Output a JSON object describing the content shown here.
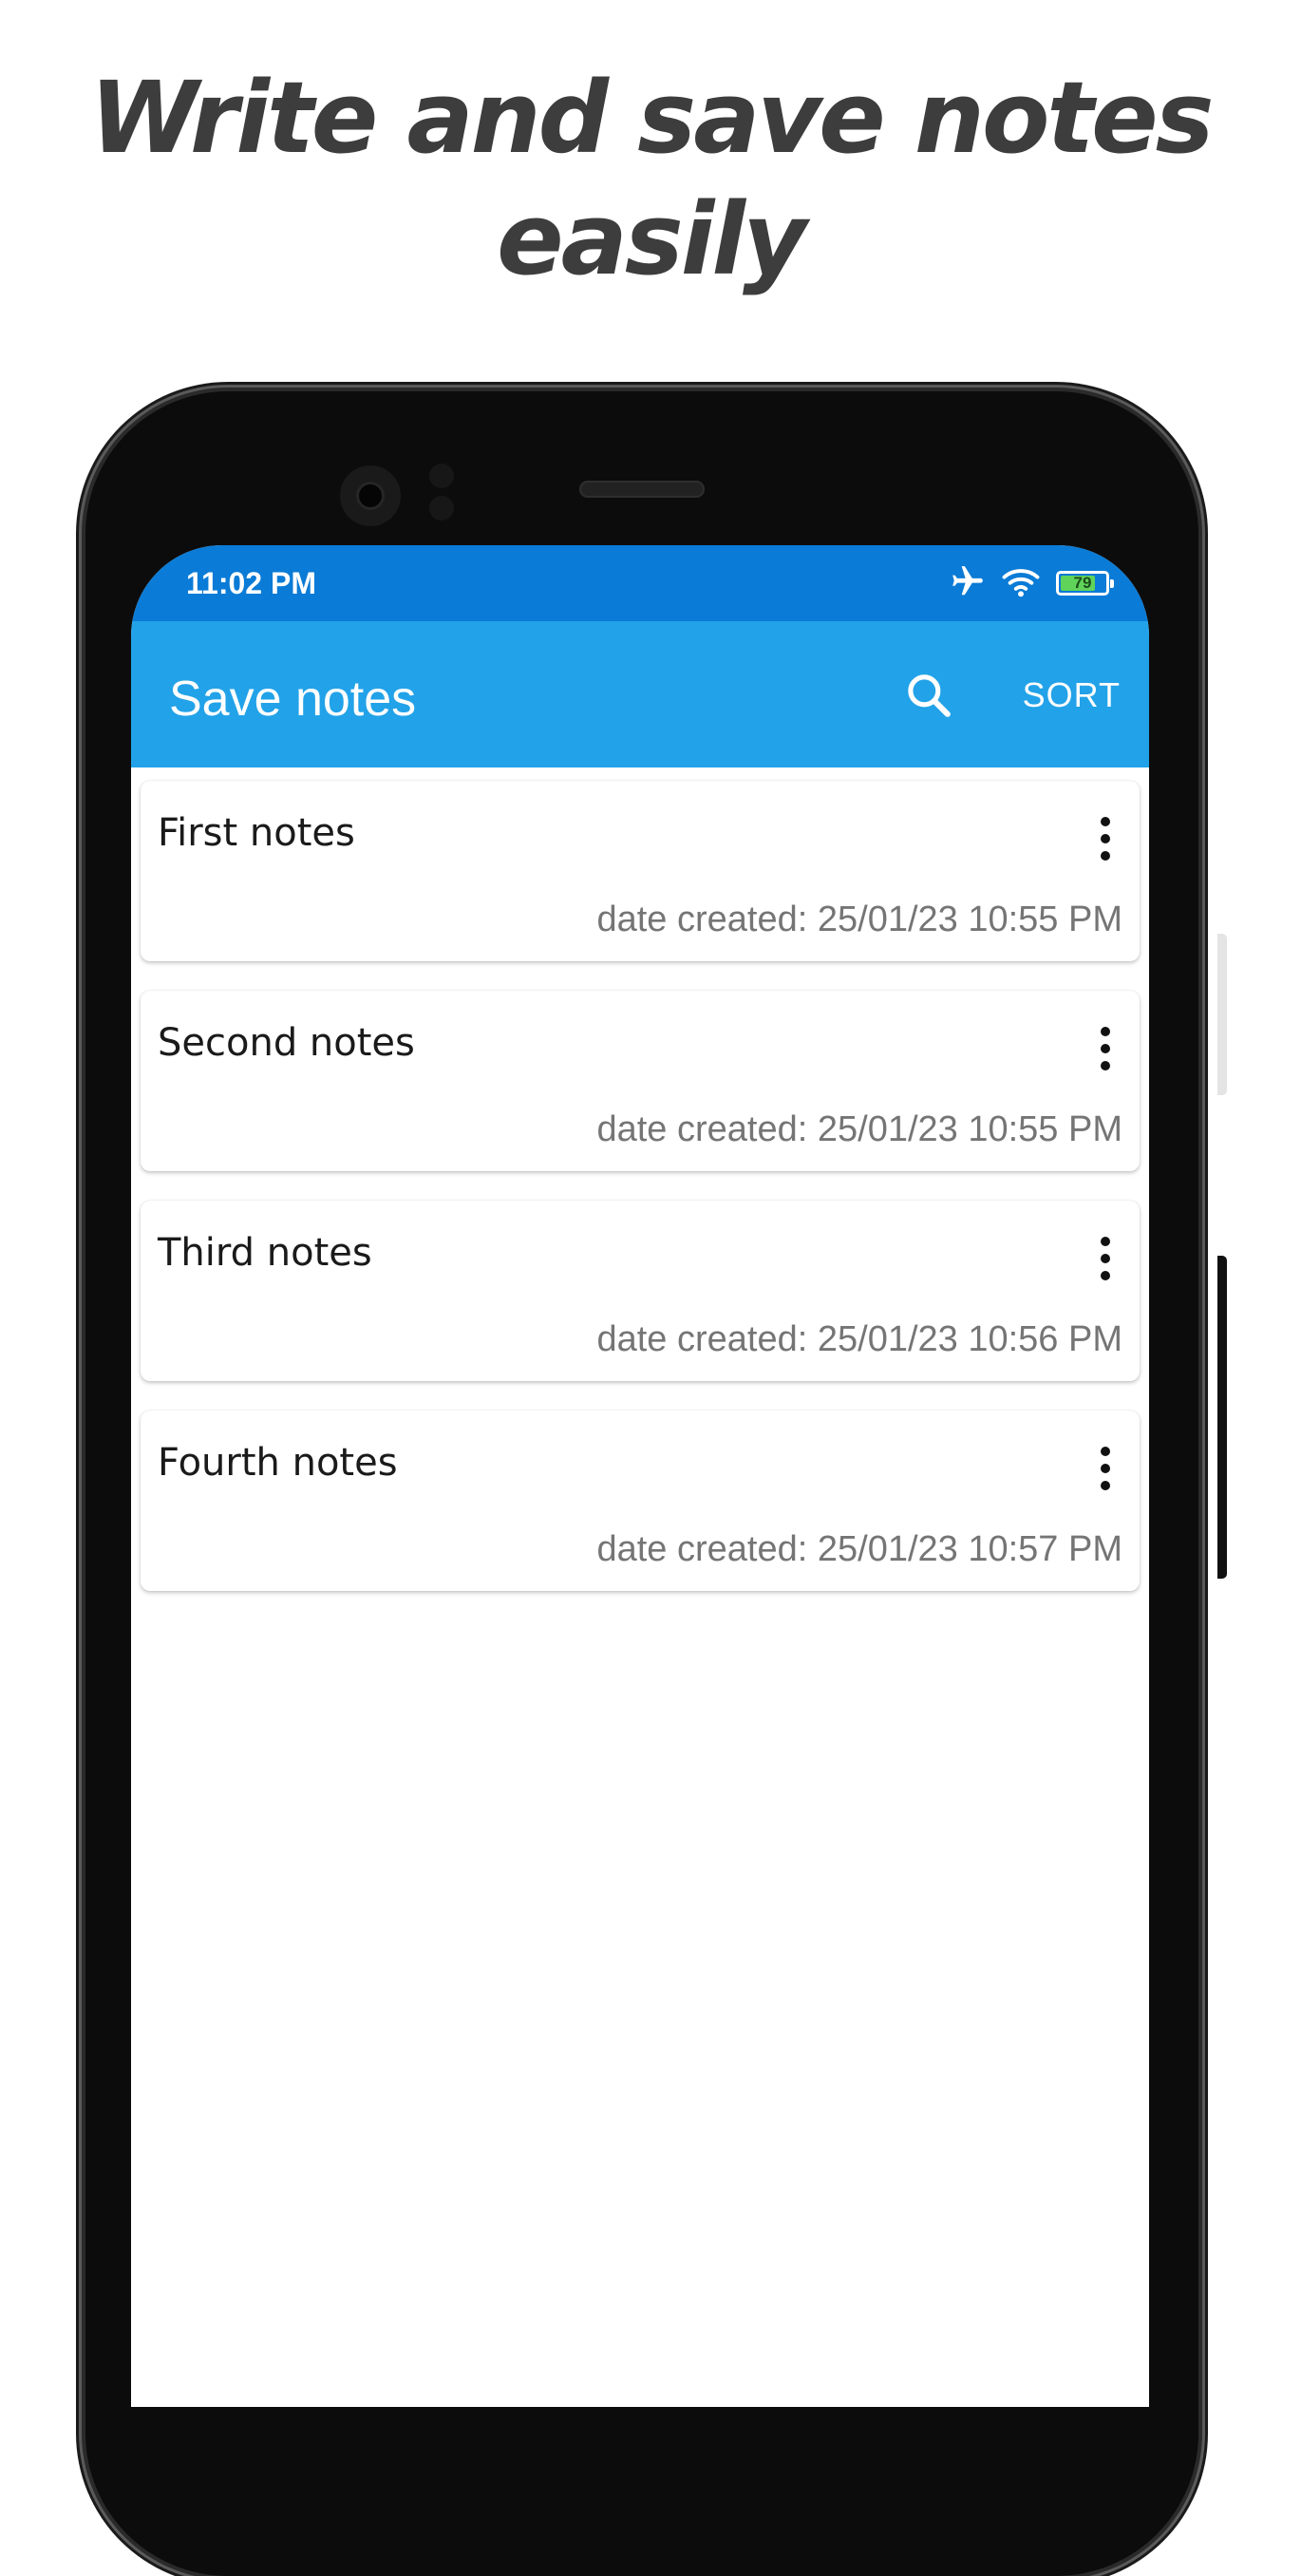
{
  "headline": {
    "line1": "Write and save notes",
    "line2": "easily"
  },
  "status_bar": {
    "time": "11:02 PM",
    "battery_level": "79",
    "battery_fraction": 0.79,
    "icons": [
      "airplane-icon",
      "wifi-icon",
      "battery-icon"
    ]
  },
  "app_bar": {
    "title": "Save notes",
    "search_icon": "search-icon",
    "sort_label": "SORT"
  },
  "notes": [
    {
      "title": "First notes",
      "date": "date created: 25/01/23 10:55 PM"
    },
    {
      "title": "Second notes",
      "date": "date created: 25/01/23 10:55 PM"
    },
    {
      "title": "Third notes",
      "date": "date created: 25/01/23 10:56 PM"
    },
    {
      "title": "Fourth notes",
      "date": "date created: 25/01/23 10:57 PM"
    }
  ],
  "colors": {
    "status_bar": "#0a7bd6",
    "app_bar": "#22a2e8",
    "headline": "#3d3d3d",
    "date_text": "#757575",
    "battery_fill": "#5fd35a"
  }
}
